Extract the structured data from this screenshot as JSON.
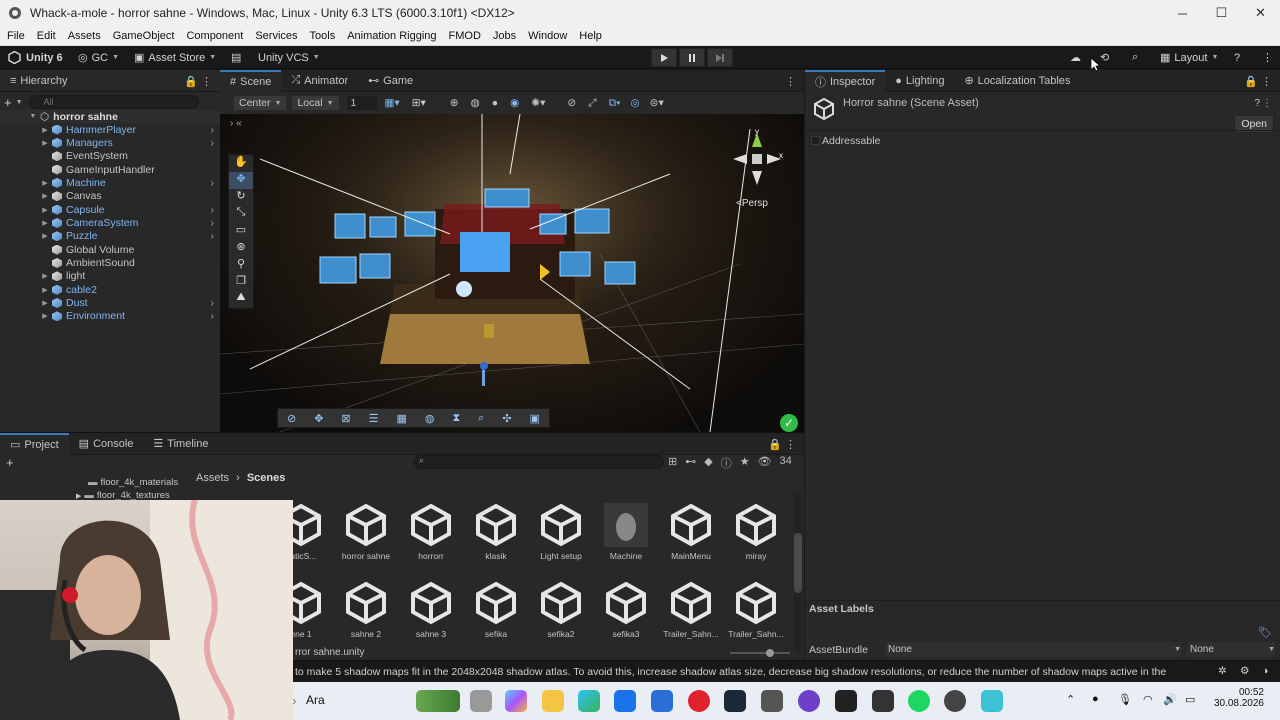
{
  "window": {
    "title": "Whack-a-mole - horror sahne - Windows, Mac, Linux - Unity 6.3 LTS (6000.3.10f1) <DX12>",
    "minimize": "─",
    "maximize": "☐",
    "close": "✕"
  },
  "menu": [
    "File",
    "Edit",
    "Assets",
    "GameObject",
    "Component",
    "Services",
    "Tools",
    "Animation Rigging",
    "FMOD",
    "Jobs",
    "Window",
    "Help"
  ],
  "toolbar": {
    "unity_label": "Unity 6",
    "gc_label": "GC",
    "asset_store_label": "Asset Store",
    "vcs_label": "Unity VCS",
    "layout_label": "Layout"
  },
  "hierarchy": {
    "tab": "Hierarchy",
    "search_placeholder": "All",
    "scene_name": "horror sahne",
    "items": [
      {
        "label": "HammerPlayer",
        "prefab": true
      },
      {
        "label": "Managers",
        "prefab": true
      },
      {
        "label": "EventSystem",
        "prefab": false
      },
      {
        "label": "GameInputHandler",
        "prefab": false
      },
      {
        "label": "Machine",
        "prefab": true
      },
      {
        "label": "Canvas",
        "prefab": false
      },
      {
        "label": "Capsule",
        "prefab": true
      },
      {
        "label": "CameraSystem",
        "prefab": true
      },
      {
        "label": "Puzzle",
        "prefab": true
      },
      {
        "label": "Global Volume",
        "prefab": false
      },
      {
        "label": "AmbientSound",
        "prefab": false
      },
      {
        "label": "light",
        "prefab": false
      },
      {
        "label": "cable2",
        "prefab": true
      },
      {
        "label": "Dust",
        "prefab": true
      },
      {
        "label": "Environment",
        "prefab": true
      }
    ]
  },
  "scene": {
    "tabs": [
      "Scene",
      "Animator",
      "Game"
    ],
    "pivot_label": "Center",
    "space_label": "Local",
    "grid_value": "1",
    "persp_label": "<Persp"
  },
  "inspector": {
    "tabs": [
      "Inspector",
      "Lighting",
      "Localization Tables"
    ],
    "asset_title": "Horror sahne (Scene Asset)",
    "open_label": "Open",
    "addressable_label": "Addressable",
    "asset_labels": "Asset Labels",
    "asset_bundle_label": "AssetBundle",
    "bundle_value": "None",
    "variant_value": "None"
  },
  "project": {
    "tabs": [
      "Project",
      "Console",
      "Timeline"
    ],
    "breadcrumb": [
      "Assets",
      "Scenes"
    ],
    "count": "34",
    "folders": [
      "floor_4k_materials",
      "floor_4k_textures"
    ],
    "row1": [
      "naticS...",
      "horror sahne",
      "horrorr",
      "klasik",
      "Light setup",
      "Machine",
      "MainMenu",
      "miray"
    ],
    "row2": [
      "hne 1",
      "sahne 2",
      "sahne 3",
      "sefika",
      "sefika2",
      "sefika3",
      "Trailer_Sahn...",
      "Trailer_Sahn..."
    ],
    "selected_file": "rror sahne.unity"
  },
  "status": {
    "message": "to make 5 shadow maps fit in the 2048x2048 shadow atlas. To avoid this, increase shadow atlas size, decrease big shadow resolutions, or reduce the number of shadow maps active in the"
  },
  "taskbar": {
    "search_label": "Ara",
    "time": "00:52",
    "date": "30.08.2026"
  },
  "colors": {
    "accent": "#3a79bb",
    "prefab": "#7fb6f0"
  }
}
